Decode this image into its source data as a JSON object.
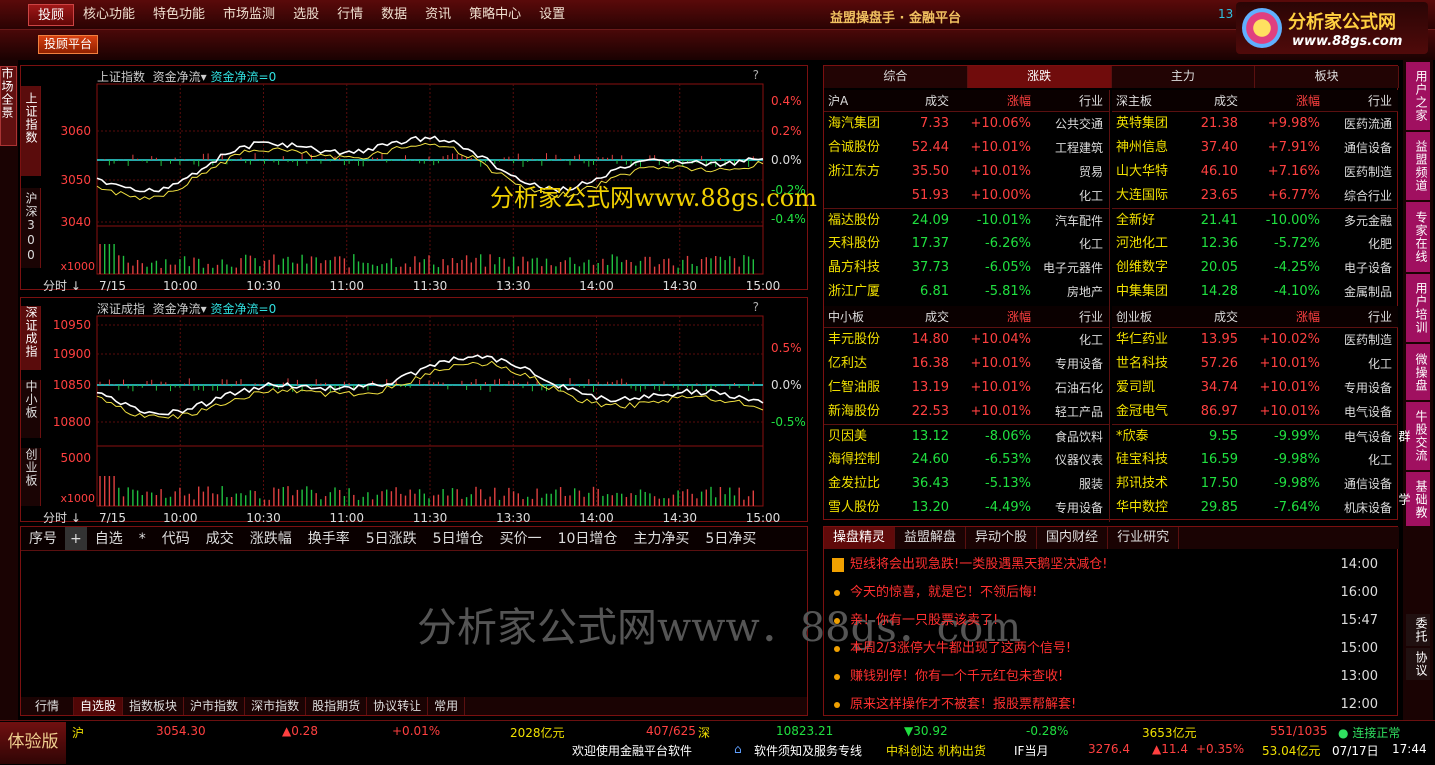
{
  "menu": [
    "投顾",
    "核心功能",
    "特色功能",
    "市场监测",
    "选股",
    "行情",
    "数据",
    "资讯",
    "策略中心",
    "设置"
  ],
  "brand": "益盟操盘手 · 金融平台",
  "top_btn": "投顾平台",
  "logo": {
    "title": "分析家公式网",
    "url": "www.88gs.com"
  },
  "left_tab": "市场全景",
  "chart1": {
    "label": "上证指数",
    "label2": "沪深300",
    "title": "上证指数",
    "ind": "资金净流",
    "ind_val": "资金净流=0",
    "yticks": [
      "3060",
      "3050",
      "3040"
    ],
    "pct": [
      "0.4%",
      "0.2%",
      "0.0%",
      "-0.2%",
      "-0.4%"
    ],
    "vol": "x1000",
    "foot": "分时"
  },
  "chart2": {
    "label": "深证成指",
    "label2": "中小板",
    "label3": "创业板",
    "title": "深证成指",
    "ind": "资金净流",
    "ind_val": "资金净流=0",
    "yticks": [
      "10950",
      "10900",
      "10850",
      "10800"
    ],
    "pct": [
      "0.5%",
      "0.0%",
      "-0.5%"
    ],
    "vol": "x1000",
    "vol_tick": "5000",
    "foot": "分时"
  },
  "times": [
    "7/15",
    "10:00",
    "10:30",
    "11:00",
    "11:30",
    "13:30",
    "14:00",
    "14:30",
    "15:00"
  ],
  "q": "?",
  "market": {
    "tabs": [
      "综合",
      "涨跌",
      "主力",
      "板块"
    ],
    "sections": [
      {
        "title": "沪A",
        "cols": [
          "成交",
          "涨幅",
          "行业"
        ],
        "rows": [
          [
            "海汽集团",
            "7.33",
            "+10.06%",
            "公共交通"
          ],
          [
            "合诚股份",
            "52.44",
            "+10.01%",
            "工程建筑"
          ],
          [
            "浙江东方",
            "35.50",
            "+10.01%",
            "贸易"
          ],
          [
            "",
            "51.93",
            "+10.00%",
            "化工"
          ],
          [
            "福达股份",
            "24.09",
            "-10.01%",
            "汽车配件"
          ],
          [
            "天科股份",
            "17.37",
            "-6.26%",
            "化工"
          ],
          [
            "晶方科技",
            "37.73",
            "-6.05%",
            "电子元器件"
          ],
          [
            "浙江广厦",
            "6.81",
            "-5.81%",
            "房地产"
          ]
        ]
      },
      {
        "title": "深主板",
        "cols": [
          "成交",
          "涨幅",
          "行业"
        ],
        "rows": [
          [
            "英特集团",
            "21.38",
            "+9.98%",
            "医药流通"
          ],
          [
            "神州信息",
            "37.40",
            "+7.91%",
            "通信设备"
          ],
          [
            "山大华特",
            "46.10",
            "+7.16%",
            "医药制造"
          ],
          [
            "大连国际",
            "23.65",
            "+6.77%",
            "综合行业"
          ],
          [
            "全新好",
            "21.41",
            "-10.00%",
            "多元金融"
          ],
          [
            "河池化工",
            "12.36",
            "-5.72%",
            "化肥"
          ],
          [
            "创维数字",
            "20.05",
            "-4.25%",
            "电子设备"
          ],
          [
            "中集集团",
            "14.28",
            "-4.10%",
            "金属制品"
          ]
        ]
      },
      {
        "title": "中小板",
        "cols": [
          "成交",
          "涨幅",
          "行业"
        ],
        "rows": [
          [
            "丰元股份",
            "14.80",
            "+10.04%",
            "化工"
          ],
          [
            "亿利达",
            "16.38",
            "+10.01%",
            "专用设备"
          ],
          [
            "仁智油服",
            "13.19",
            "+10.01%",
            "石油石化"
          ],
          [
            "新海股份",
            "22.53",
            "+10.01%",
            "轻工产品"
          ],
          [
            "贝因美",
            "13.12",
            "-8.06%",
            "食品饮料"
          ],
          [
            "海得控制",
            "24.60",
            "-6.53%",
            "仪器仪表"
          ],
          [
            "金发拉比",
            "36.43",
            "-5.13%",
            "服装"
          ],
          [
            "雪人股份",
            "13.20",
            "-4.49%",
            "专用设备"
          ]
        ]
      },
      {
        "title": "创业板",
        "cols": [
          "成交",
          "涨幅",
          "行业"
        ],
        "rows": [
          [
            "华仁药业",
            "13.95",
            "+10.02%",
            "医药制造"
          ],
          [
            "世名科技",
            "57.26",
            "+10.01%",
            "化工"
          ],
          [
            "爱司凯",
            "34.74",
            "+10.01%",
            "专用设备"
          ],
          [
            "金冠电气",
            "86.97",
            "+10.01%",
            "电气设备"
          ],
          [
            "*欣泰",
            "9.55",
            "-9.99%",
            "电气设备"
          ],
          [
            "硅宝科技",
            "16.59",
            "-9.98%",
            "化工"
          ],
          [
            "邦讯技术",
            "17.50",
            "-9.98%",
            "通信设备"
          ],
          [
            "华中数控",
            "29.85",
            "-7.64%",
            "机床设备"
          ]
        ]
      }
    ]
  },
  "watch": {
    "headers": [
      "序号",
      "+",
      "自选",
      "*",
      "代码",
      "成交",
      "涨跌幅",
      "换手率",
      "5日涨跌",
      "5日增仓",
      "买价一",
      "10日增仓",
      "主力净买",
      "5日净买"
    ],
    "tabs": [
      "行情",
      "自选股",
      "指数板块",
      "沪市指数",
      "深市指数",
      "股指期货",
      "协议转让",
      "常用"
    ]
  },
  "news": {
    "tabs": [
      "操盘精灵",
      "益盟解盘",
      "异动个股",
      "国内财经",
      "行业研究"
    ],
    "items": [
      [
        "短线将会出现急跌!一类股遇黑天鹅坚决减仓!",
        "14:00"
      ],
      [
        "今天的惊喜，就是它！不领后悔!",
        "16:00"
      ],
      [
        "亲！你有一只股票该卖了!",
        "15:47"
      ],
      [
        "本周2/3涨停大牛都出现了这两个信号!",
        "15:00"
      ],
      [
        "赚钱别停！你有一个千元红包未查收!",
        "13:00"
      ],
      [
        "原来这样操作才不被套！报股票帮解套!",
        "12:00"
      ]
    ]
  },
  "right_tabs": [
    "用户之家",
    "益盟频道",
    "专家在线",
    "用户培训",
    "微操盘",
    "牛股交流群",
    "基础教学",
    "委托",
    "协议"
  ],
  "status": {
    "badge": "体验版",
    "sh": "沪",
    "sh_val": "3054.30",
    "sh_chg": "▲0.28",
    "sh_pct": "+0.01%",
    "sh_amt": "2028亿元",
    "sh_ud": "407/625",
    "sz": "深",
    "sz_val": "10823.21",
    "sz_chg": "▼30.92",
    "sz_pct": "-0.28%",
    "sz_amt": "3653亿元",
    "sz_ud": "551/1035",
    "conn": "连接正常",
    "welcome": "欢迎使用金融平台软件",
    "notice": "软件须知及服务专线",
    "news_tick": "中科创达 机构出货",
    "if_label": "IF当月",
    "if_val": "3276.4",
    "if_chg": "▲11.4",
    "if_pct": "+0.35%",
    "if_amt": "53.04亿元",
    "date": "07/17日",
    "time": "17:44",
    "top_num": "13"
  },
  "watermarks": [
    "分析家公式网www.88gs.com",
    "分析家公式网www．88gs．com"
  ],
  "colors": {
    "up": "#ff4040",
    "down": "#20e040",
    "name": "#f0e000",
    "cyan": "#30e0e0"
  }
}
